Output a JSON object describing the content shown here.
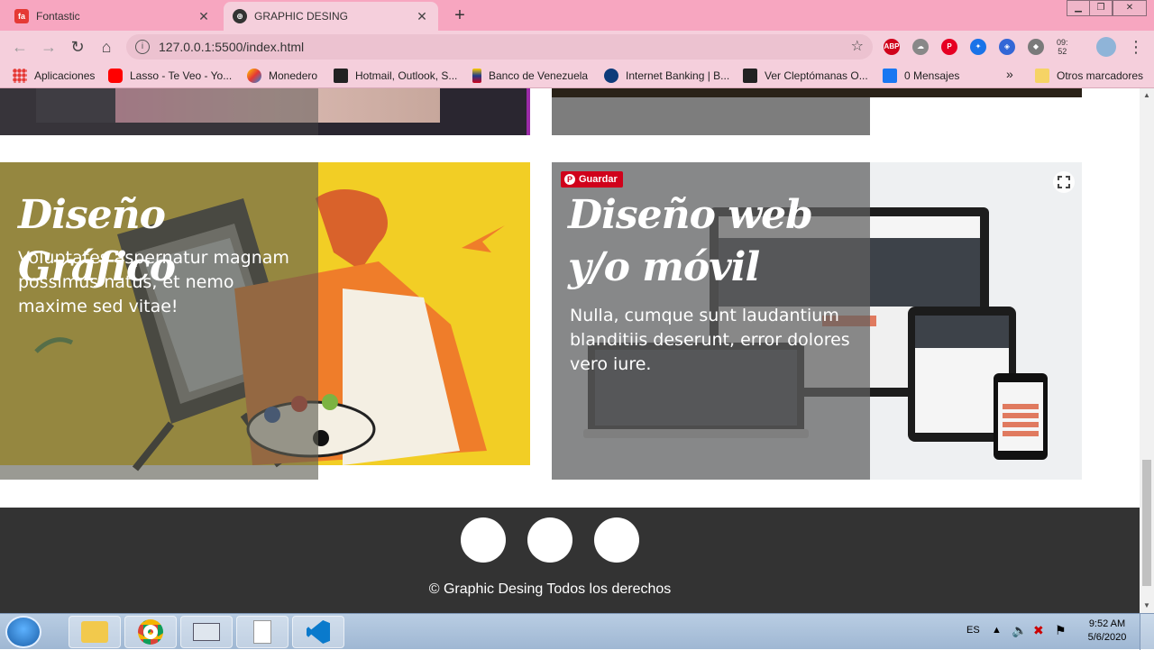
{
  "browser": {
    "tabs": [
      {
        "title": "Fontastic",
        "active": false,
        "favicon": "fontastic-icon"
      },
      {
        "title": "GRAPHIC DESING",
        "active": true,
        "favicon": "globe-icon"
      }
    ],
    "new_tab": "+",
    "url": "127.0.0.1:5500/index.html",
    "ext_clock": [
      "09:",
      "52"
    ],
    "bookmarks": [
      {
        "label": "Aplicaciones",
        "icon": "apps-grid-icon"
      },
      {
        "label": "Lasso - Te Veo - Yo...",
        "icon": "youtube-icon"
      },
      {
        "label": "Monedero",
        "icon": "monedero-icon"
      },
      {
        "label": "Hotmail, Outlook, S...",
        "icon": "hotmail-icon"
      },
      {
        "label": "Banco de Venezuela",
        "icon": "bank-icon"
      },
      {
        "label": "Internet Banking | B...",
        "icon": "internet-banking-icon"
      },
      {
        "label": "Ver Cleptómanas O...",
        "icon": "clapper-icon"
      },
      {
        "label": "0 Mensajes",
        "icon": "facebook-icon"
      }
    ],
    "bookmarks_more": "»",
    "other_bookmarks": "Otros marcadores"
  },
  "page": {
    "cards": [
      {
        "title": "Diseño Gráfico",
        "text": "Voluptates aspernatur magnam possimus natus, et nemo maxime sed vitae!"
      },
      {
        "title": "Diseño web y/o móvil",
        "text": "Nulla, cumque sunt laudantium blanditiis deserunt, error dolores vero iure.",
        "pin_label": "Guardar"
      }
    ],
    "footer": {
      "copyright": "© Graphic Desing Todos los derechos"
    }
  },
  "taskbar": {
    "language": "ES",
    "time": "9:52 AM",
    "date": "5/6/2020"
  },
  "colors": {
    "tab_strip": "#f7a6c0",
    "toolbar": "#f5cfdc",
    "footer": "#333333",
    "overlay": "rgba(90,90,90,0.65)",
    "pin": "#d0021b"
  }
}
